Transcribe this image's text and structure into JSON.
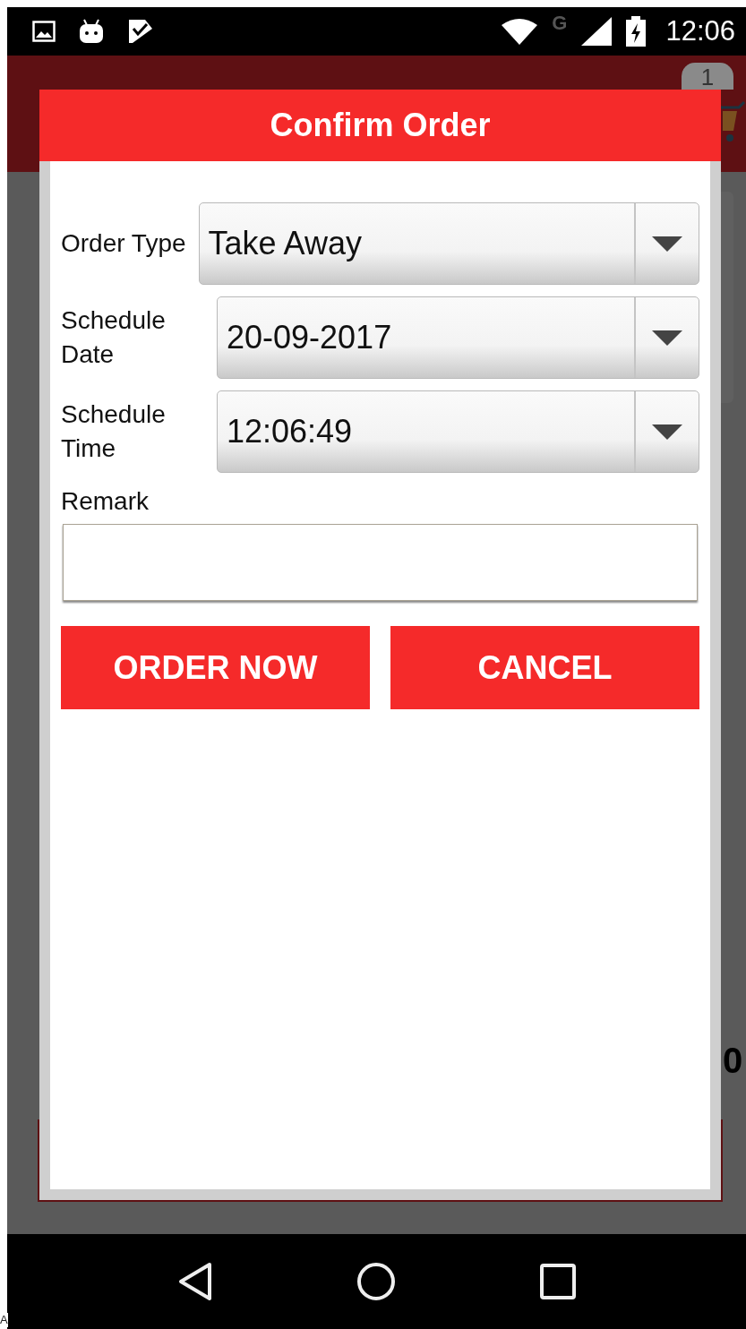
{
  "status_bar": {
    "network": "G",
    "time": "12:06"
  },
  "background": {
    "cart_badge": "1",
    "total_fragment": "0"
  },
  "dialog": {
    "title": "Confirm Order",
    "fields": [
      {
        "kind": "dropdown",
        "label": "Order Type",
        "value": "Take Away"
      },
      {
        "kind": "dropdown",
        "label": "Schedule Date",
        "value": "20-09-2017"
      },
      {
        "kind": "dropdown",
        "label": "Schedule Time",
        "value": "12:06:49"
      },
      {
        "kind": "text",
        "label": "Remark"
      }
    ],
    "buttons": [
      "ORDER NOW",
      "CANCEL"
    ]
  },
  "edge_text": "A"
}
